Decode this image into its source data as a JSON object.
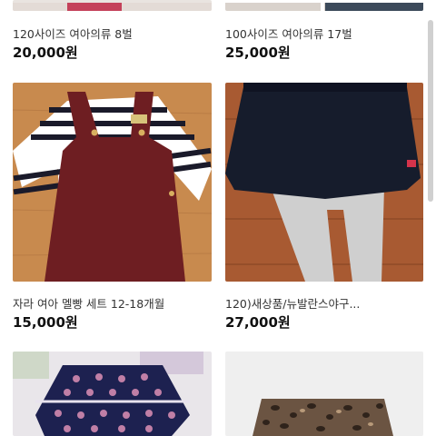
{
  "products": [
    {
      "title": "120사이즈 여아의류 8벌",
      "price": "20,000원"
    },
    {
      "title": "100사이즈 여아의류 17벌",
      "price": "25,000원"
    },
    {
      "title": "자라 여아 멜빵 세트 12-18개월",
      "price": "15,000원"
    },
    {
      "title": "120)새상품/뉴발란스야구...",
      "price": "27,000원"
    },
    {
      "title": "",
      "price": ""
    },
    {
      "title": "",
      "price": ""
    }
  ],
  "icons": {
    "scroll": "scrollbar-thumb"
  }
}
